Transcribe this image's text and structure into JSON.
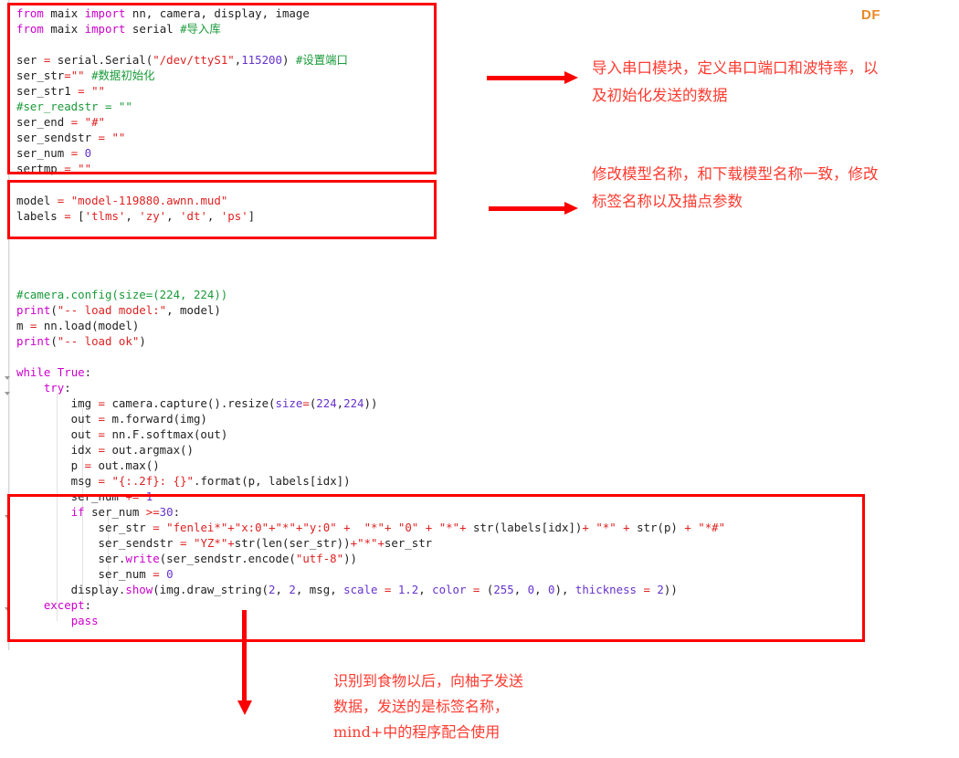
{
  "brand": {
    "label": "DF",
    "color": "#e98a28"
  },
  "accent": {
    "annotation_red": "#ff3b30",
    "box_red": "#fb0000"
  },
  "editor": {
    "language": "python",
    "lines": [
      "from maix import nn, camera, display, image",
      "from maix import serial #导入库",
      "",
      "ser = serial.Serial(\"/dev/ttyS1\",115200) #设置端口",
      "ser_str=\"\" #数据初始化",
      "ser_str1 = \"\"",
      "#ser_readstr = \"\"",
      "ser_end = \"#\"",
      "ser_sendstr = \"\"",
      "ser_num = 0",
      "sertmp = \"\"",
      "",
      "",
      "model = \"model-119880.awnn.mud\"",
      "labels = ['tlms', 'zy', 'dt', 'ps']",
      "",
      "",
      "",
      "",
      "",
      "#camera.config(size=(224, 224))",
      "print(\"-- load model:\", model)",
      "m = nn.load(model)",
      "print(\"-- load ok\")",
      "",
      "while True:",
      "    try:",
      "        img = camera.capture().resize(size=(224,224))",
      "        out = m.forward(img)",
      "        out = nn.F.softmax(out)",
      "        idx = out.argmax()",
      "        p = out.max()",
      "        msg = \"{:.2f}: {}\".format(p, labels[idx])",
      "        ser_num += 1",
      "        if ser_num >=30:",
      "            ser_str = \"fenlei*\"+\"x:0\"+\"*\"+\"y:0\" +  \"*\"+ \"0\" + \"*\"+ str(labels[idx])+ \"*\" + str(p) + \"*#\"",
      "            ser_sendstr = \"YZ*\"+str(len(ser_str))+\"*\"+ser_str",
      "            ser.write(ser_sendstr.encode(\"utf-8\"))",
      "            ser_num = 0",
      "        display.show(img.draw_string(2, 2, msg, scale = 1.2, color = (255, 0, 0), thickness = 2))",
      "    except:",
      "        pass"
    ]
  },
  "highlights": [
    {
      "id": "box-serial-setup",
      "label": "serial setup code block"
    },
    {
      "id": "box-model-labels",
      "label": "model and labels block"
    },
    {
      "id": "box-send-data",
      "label": "serial send data block"
    }
  ],
  "annotations": [
    {
      "id": "annot-serial",
      "text": "导入串口模块，定义串口端口和波特率，以\n及初始化发送的数据"
    },
    {
      "id": "annot-model",
      "text": "修改模型名称，和下载模型名称一致，修改\n标签名称以及描点参数"
    },
    {
      "id": "annot-send",
      "text": "识别到食物以后，向柚子发送\n数据，发送的是标签名称，\nmind+中的程序配合使用"
    }
  ]
}
